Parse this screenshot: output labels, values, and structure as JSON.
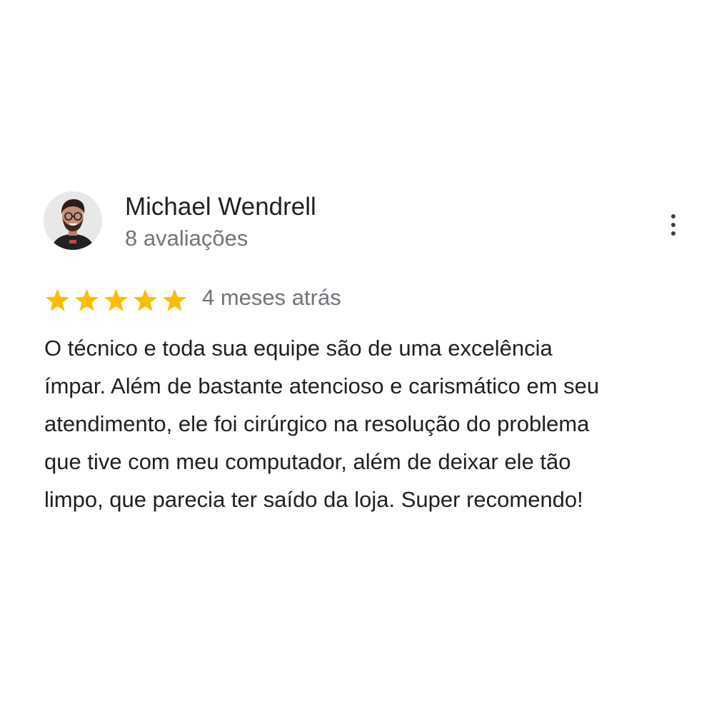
{
  "review": {
    "author": {
      "name": "Michael Wendrell",
      "review_count": "8 avaliações",
      "avatar_icon": "user-avatar-photo"
    },
    "menu_icon": "more-vert-icon",
    "rating": {
      "stars": 5,
      "max_stars": 5,
      "star_color": "#fbbc04",
      "star_icon": "star-icon"
    },
    "date": "4 meses atrás",
    "text_lines": [
      "O técnico e toda sua equipe são de uma excelência",
      "ímpar. Além de bastante atencioso e carismático em seu",
      "atendimento, ele foi cirúrgico na resolução do problema",
      "que tive com meu computador, além de deixar ele tão",
      "limpo, que parecia ter saído da loja. Super recomendo!"
    ]
  },
  "colors": {
    "name_text": "#202124",
    "secondary_text": "#70757a",
    "body_text": "#202124",
    "background": "#ffffff"
  }
}
